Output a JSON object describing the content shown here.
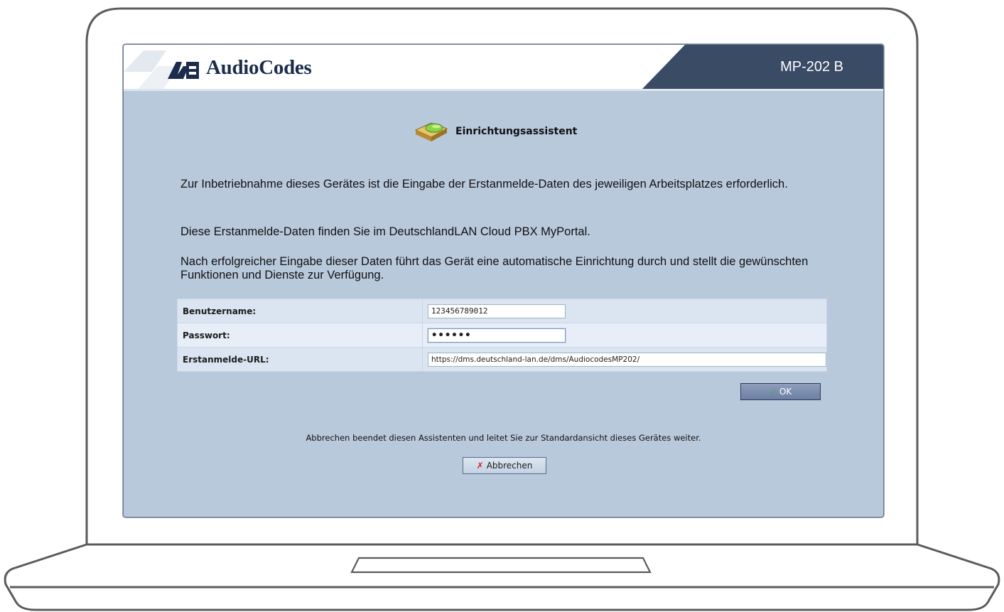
{
  "header": {
    "logo_text": "AudioCodes",
    "model": "MP-202 B"
  },
  "wizard": {
    "title": "Einrichtungsassistent",
    "paragraphs": [
      "Zur Inbetriebnahme dieses Gerätes ist die Eingabe der Erstanmelde-Daten des jeweiligen Arbeitsplatzes erforderlich.",
      "Diese Erstanmelde-Daten finden Sie im DeutschlandLAN Cloud PBX MyPortal.",
      "Nach erfolgreicher Eingabe dieser Daten führt das Gerät eine automatische Einrichtung durch und stellt die gewünschten Funktionen und Dienste zur Verfügung."
    ]
  },
  "form": {
    "username_label": "Benutzername:",
    "username_value": "123456789012",
    "password_label": "Passwort:",
    "password_value": "••••••",
    "url_label": "Erstanmelde-URL:",
    "url_value": "https://dms.deutschland-lan.de/dms/AudiocodesMP202/"
  },
  "buttons": {
    "ok_label": "OK",
    "cancel_note": "Abbrechen beendet diesen Assistenten und leitet Sie zur Standardansicht dieses Gerätes weiter.",
    "cancel_label": "Abbrechen"
  },
  "colors": {
    "page_background": "#b9c9dc",
    "header_dark": "#3a4b66",
    "logo_text": "#1b2c4c"
  }
}
